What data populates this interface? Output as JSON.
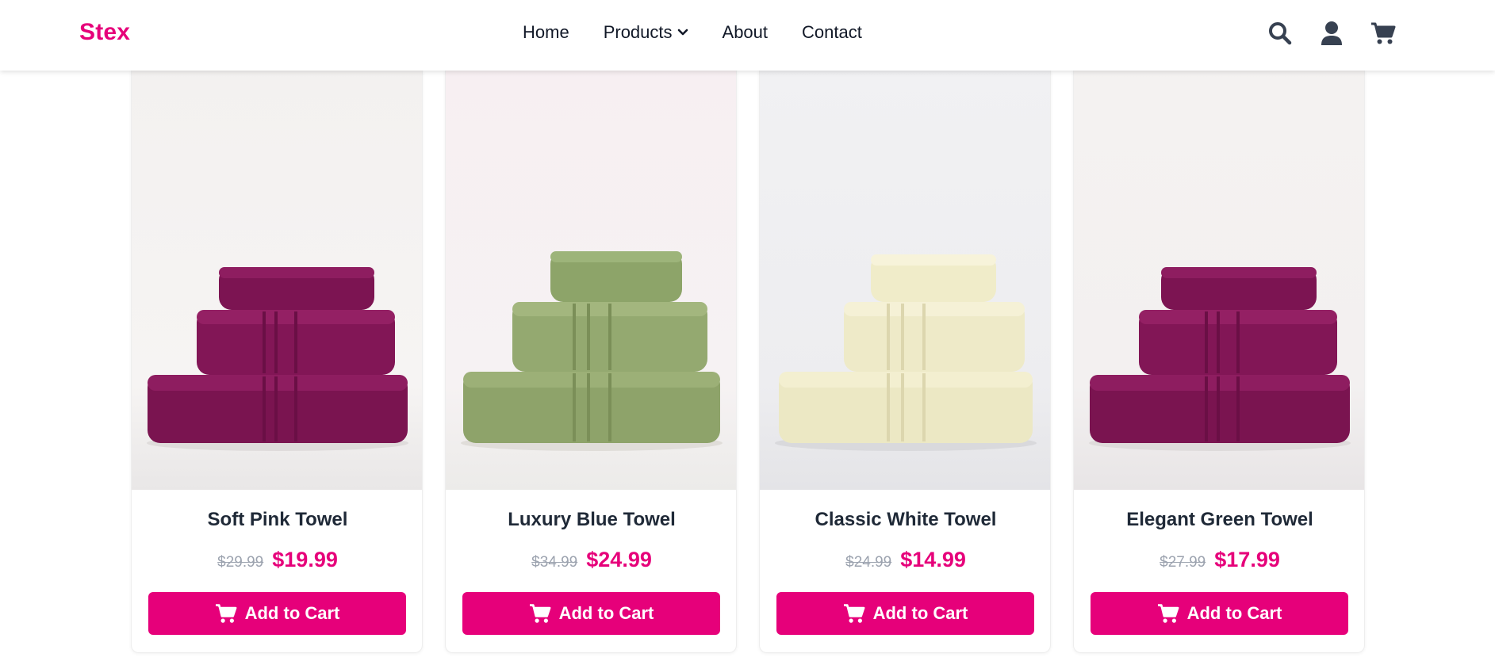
{
  "navbar": {
    "brand": "Stex",
    "links": [
      {
        "label": "Home"
      },
      {
        "label": "Products",
        "has_dropdown": true
      },
      {
        "label": "About"
      },
      {
        "label": "Contact"
      }
    ],
    "icons": [
      "search-icon",
      "user-icon",
      "cart-icon"
    ]
  },
  "colors": {
    "accent": "#e6007a",
    "old_price": "#9ca3af",
    "text": "#1f2937"
  },
  "products": [
    {
      "title": "Soft Pink Towel",
      "old_price": "$29.99",
      "price": "$19.99",
      "button": "Add to Cart",
      "towel_color": "plum"
    },
    {
      "title": "Luxury Blue Towel",
      "old_price": "$34.99",
      "price": "$24.99",
      "button": "Add to Cart",
      "towel_color": "sage green"
    },
    {
      "title": "Classic White Towel",
      "old_price": "$24.99",
      "price": "$14.99",
      "button": "Add to Cart",
      "towel_color": "cream"
    },
    {
      "title": "Elegant Green Towel",
      "old_price": "$27.99",
      "price": "$17.99",
      "button": "Add to Cart",
      "towel_color": "plum"
    }
  ]
}
